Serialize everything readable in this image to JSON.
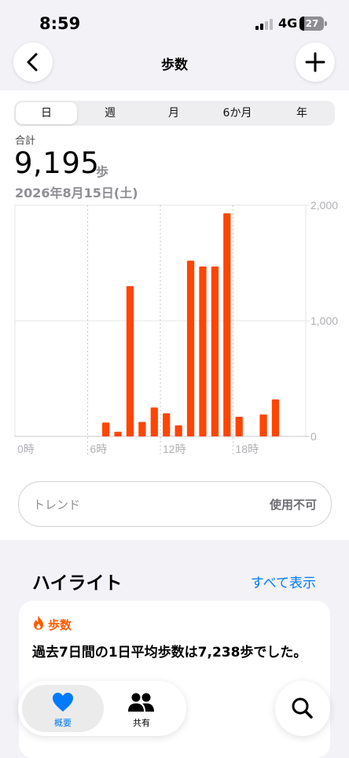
{
  "status_bar": {
    "time": "8:59",
    "network": "4G",
    "battery": "27"
  },
  "nav": {
    "title": "歩数",
    "back_icon": "chevron-left-icon",
    "add_icon": "plus-icon"
  },
  "segments": [
    {
      "label": "日",
      "selected": true
    },
    {
      "label": "週",
      "selected": false
    },
    {
      "label": "月",
      "selected": false
    },
    {
      "label": "6か月",
      "selected": false
    },
    {
      "label": "年",
      "selected": false
    }
  ],
  "summary": {
    "label": "合計",
    "value": "9,195",
    "unit": "歩",
    "date": "2026年8月15日(土)"
  },
  "chart_data": {
    "type": "bar",
    "x_unit": "hour",
    "x_ticks": [
      "0時",
      "6時",
      "12時",
      "18時"
    ],
    "y_ticks": [
      "0",
      "1,000",
      "2,000"
    ],
    "ylim": [
      0,
      2000
    ],
    "xlim": [
      0,
      24
    ],
    "grid": true,
    "bar_color": "#ff4500",
    "x": [
      7,
      8,
      9,
      10,
      11,
      12,
      13,
      14,
      15,
      16,
      17,
      18,
      20,
      21
    ],
    "values": [
      120,
      40,
      1300,
      125,
      250,
      200,
      95,
      1520,
      1470,
      1470,
      1930,
      170,
      190,
      320
    ]
  },
  "trend": {
    "label": "トレンド",
    "status": "使用不可"
  },
  "highlights": {
    "title": "ハイライト",
    "show_all": "すべて表示",
    "card": {
      "icon": "flame-icon",
      "category": "歩数",
      "text": "過去7日間の1日平均歩数は7,238歩でした。"
    }
  },
  "tabbar": {
    "tabs": [
      {
        "label": "概要",
        "icon": "heart-icon",
        "active": true
      },
      {
        "label": "共有",
        "icon": "people-icon",
        "active": false
      }
    ],
    "search_icon": "search-icon"
  },
  "colors": {
    "accent": "#007aff",
    "bars": "#ff4500",
    "highlight": "#ff5a00"
  }
}
